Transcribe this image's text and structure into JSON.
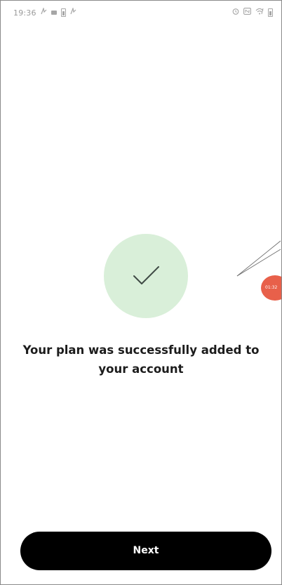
{
  "status_bar": {
    "time": "19:36",
    "left_icons": [
      "signal-icon",
      "video-icon",
      "battery-saver-icon",
      "signal-icon"
    ],
    "right_icons": [
      "alarm-icon",
      "nfc-icon",
      "wifi-icon",
      "battery-icon"
    ]
  },
  "success": {
    "icon": "checkmark-icon",
    "circle_color": "#d9efd9",
    "message_line1": "Your plan was successfully added to",
    "message_line2": "your account"
  },
  "recording_overlay": {
    "timer": "01:32",
    "color": "#e8604a"
  },
  "footer": {
    "next_label": "Next",
    "button_color": "#000000"
  }
}
